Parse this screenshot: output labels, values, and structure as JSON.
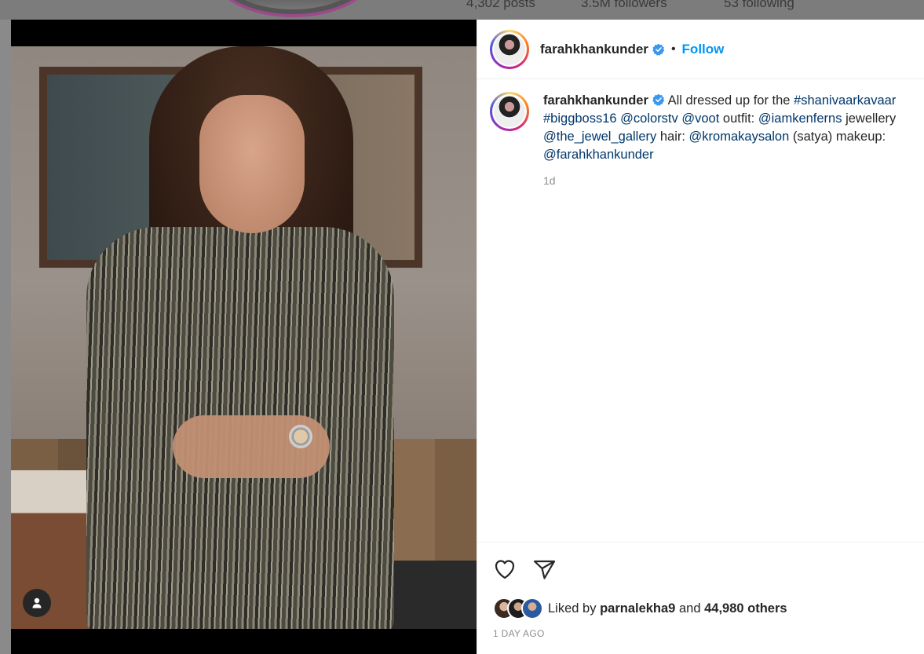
{
  "background": {
    "stats": [
      "4,302 posts",
      "3.5M followers",
      "53 following"
    ]
  },
  "post": {
    "username": "farahkhankunder",
    "separator": "•",
    "follow_label": "Follow",
    "caption": {
      "username": "farahkhankunder",
      "text_1": "All dressed up for the",
      "tag_1": "#shanivaarkavaar",
      "tag_2": "#biggboss16",
      "mention_1": "@colorstv",
      "mention_2": "@voot",
      "text_2": "outfit:",
      "mention_3": "@iamkenferns",
      "text_3": "jewellery",
      "mention_4": "@the_jewel_gallery",
      "text_4": "hair:",
      "mention_5": "@kromakaysalon",
      "text_5": "(satya) makeup:",
      "mention_6": "@farahkhankunder",
      "time": "1d"
    },
    "likes": {
      "prefix": "Liked by",
      "user": "parnalekha9",
      "joiner": "and",
      "count": "44,980 others"
    },
    "date": "1 DAY AGO"
  },
  "colors": {
    "accent": "#0095f6",
    "link": "#00376b",
    "verified": "#3897f0"
  },
  "icons": {
    "verified": "verified-badge-icon",
    "like": "heart-icon",
    "share": "paper-plane-icon",
    "tag": "user-tag-icon"
  }
}
